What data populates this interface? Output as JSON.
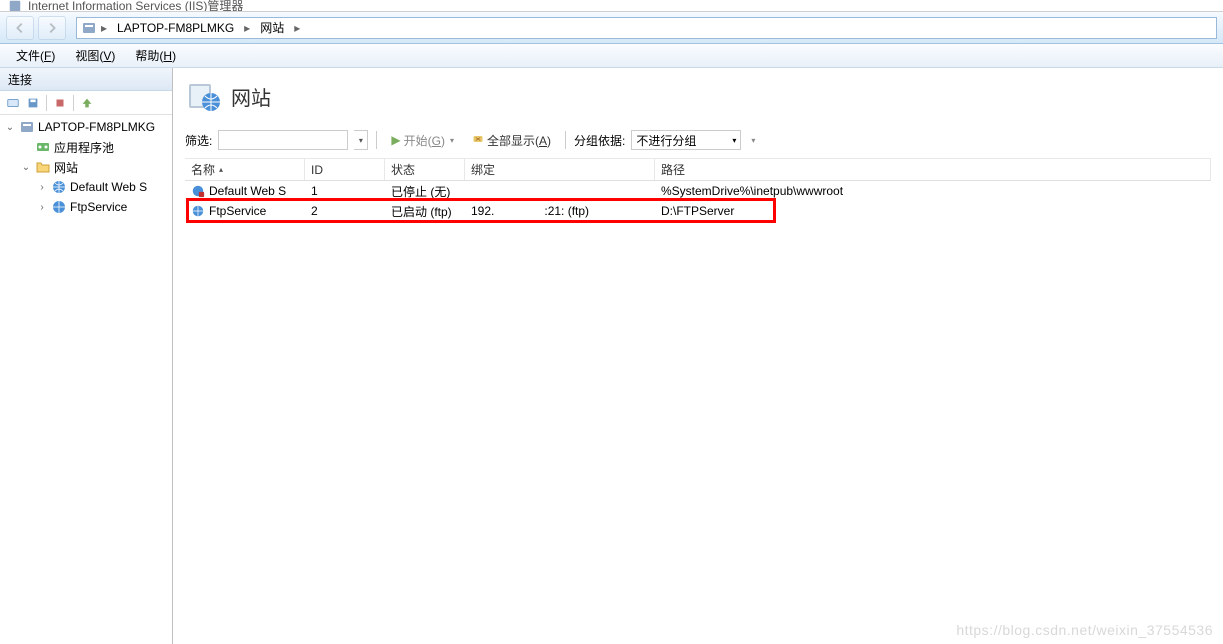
{
  "window": {
    "title": "Internet Information Services (IIS)管理器"
  },
  "breadcrumb": {
    "segments": [
      "LAPTOP-FM8PLMKG",
      "网站"
    ]
  },
  "menus": {
    "file": "文件",
    "file_key": "F",
    "view": "视图",
    "view_key": "V",
    "help": "帮助",
    "help_key": "H"
  },
  "sidebar": {
    "title": "连接",
    "root": "LAPTOP-FM8PLMKG",
    "app_pools": "应用程序池",
    "sites": "网站",
    "site_default": "Default Web S",
    "site_ftp": "FtpService"
  },
  "content": {
    "title": "网站",
    "filter_label": "筛选:",
    "start_label": "开始",
    "start_key": "G",
    "showall_label": "全部显示",
    "showall_key": "A",
    "groupby_label": "分组依据:",
    "groupby_value": "不进行分组"
  },
  "grid": {
    "columns": {
      "name": "名称",
      "id": "ID",
      "status": "状态",
      "binding": "绑定",
      "path": "路径"
    },
    "rows": [
      {
        "name": "Default Web S",
        "id": "1",
        "status": "已停止 (无)",
        "binding": "",
        "path": "%SystemDrive%\\inetpub\\wwwroot",
        "icon": "globe-stop"
      },
      {
        "name": "FtpService",
        "id": "2",
        "status": "已启动 (ftp)",
        "binding_pre": "192.",
        "binding_post": ":21: (ftp)",
        "path": "D:\\FTPServer",
        "icon": "globe"
      }
    ]
  },
  "watermark": "https://blog.csdn.net/weixin_37554536"
}
